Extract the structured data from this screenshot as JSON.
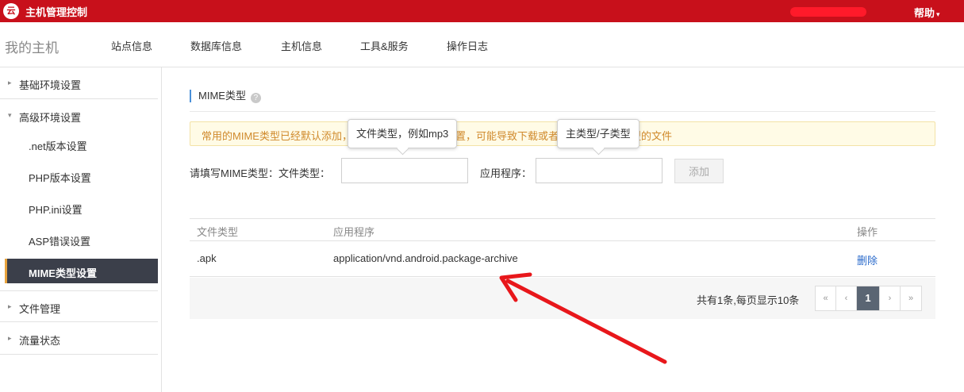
{
  "topbar": {
    "logo_glyph": "云",
    "title": "主机管理控制",
    "help_label": "帮助",
    "help_caret": "▾"
  },
  "header": {
    "host_title": "我的主机",
    "nav": [
      "站点信息",
      "数据库信息",
      "主机信息",
      "工具&服务",
      "操作日志"
    ]
  },
  "sidebar": {
    "groups": [
      {
        "label": "基础环境设置",
        "expanded": false,
        "icon": "caret-right-icon"
      },
      {
        "label": "高级环境设置",
        "expanded": true,
        "icon": "caret-down-icon"
      },
      {
        "label": "文件管理",
        "expanded": false,
        "icon": "caret-right-icon"
      },
      {
        "label": "流量状态",
        "expanded": false,
        "icon": "caret-right-icon"
      }
    ],
    "subitems": [
      ".net版本设置",
      "PHP版本设置",
      "PHP.ini设置",
      "ASP错误设置",
      "MIME类型设置"
    ],
    "active_subitem": "MIME类型设置",
    "caret_right": "▸",
    "caret_down": "▾"
  },
  "main": {
    "section_title": "MIME类型",
    "help_icon_glyph": "?",
    "notice": "常用的MIME类型已经默认添加，如果您的某类文件未设置，可能导致下载或者无法打开某些类型的文件",
    "tooltips": {
      "file_type": "文件类型，例如mp3",
      "app": "主类型/子类型"
    },
    "form": {
      "prefix_label": "请填写MIME类型：文件类型：",
      "file_type_value": "",
      "app_label": "应用程序：",
      "app_value": "",
      "add_button": "添加"
    },
    "table": {
      "headers": [
        "文件类型",
        "应用程序",
        "操作"
      ],
      "rows": [
        {
          "file_type": ".apk",
          "app": "application/vnd.android.package-archive",
          "action": "删除"
        }
      ]
    },
    "pager": {
      "summary": "共有1条,每页显示10条",
      "first": "«",
      "prev": "‹",
      "current": "1",
      "next": "›",
      "last": "»"
    }
  },
  "colors": {
    "topbar": "#c8101b",
    "active_sidebar": "#3b3f4a",
    "notice_text": "#d08a2c",
    "link": "#2a6acb",
    "annotation_arrow": "#e8171b"
  }
}
